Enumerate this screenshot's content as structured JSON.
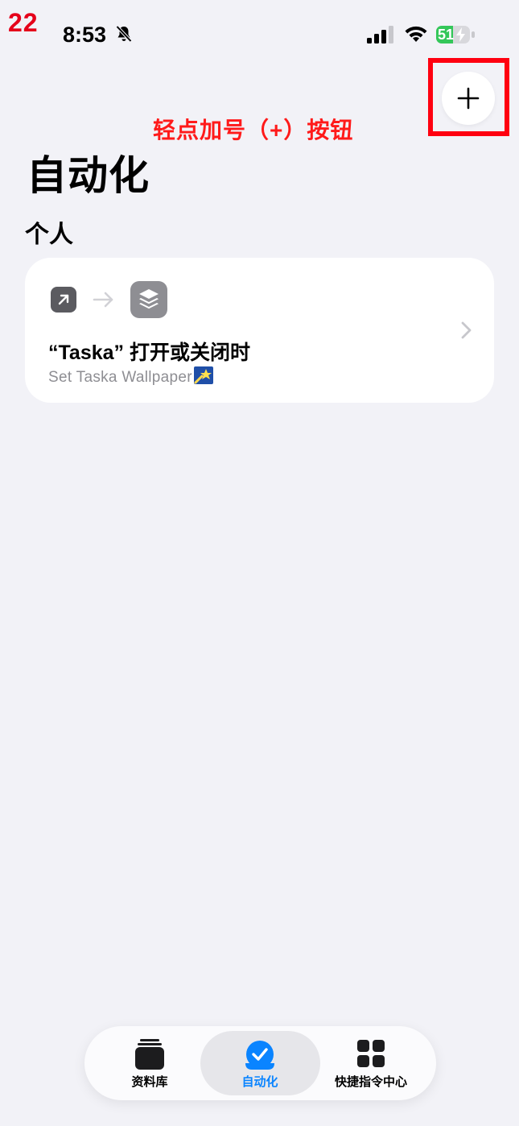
{
  "annotation": {
    "step_number": "22",
    "hint_text": "轻点加号（+）按钮",
    "highlight_color": "#ff0010"
  },
  "status_bar": {
    "time": "8:53",
    "battery_level": "51",
    "battery_color": "#34c759",
    "icons": [
      "bell-slash-icon",
      "cellular-signal-icon",
      "wifi-icon",
      "battery-icon"
    ]
  },
  "toolbar": {
    "add_button_label": "+"
  },
  "page": {
    "title": "自动化",
    "section_title": "个人"
  },
  "automation_card": {
    "trigger_icon": "app-open-icon",
    "action_icon": "shortcuts-icon",
    "title": "“Taska” 打开或关闭时",
    "subtitle": "Set Taska Wallpaper"
  },
  "tab_bar": {
    "active_color": "#0a84ff",
    "tabs": [
      {
        "label": "资料库",
        "icon": "library-stack-icon",
        "active": false
      },
      {
        "label": "自动化",
        "icon": "automation-check-icon",
        "active": true
      },
      {
        "label": "快捷指令中心",
        "icon": "gallery-grid-icon",
        "active": false
      }
    ]
  }
}
